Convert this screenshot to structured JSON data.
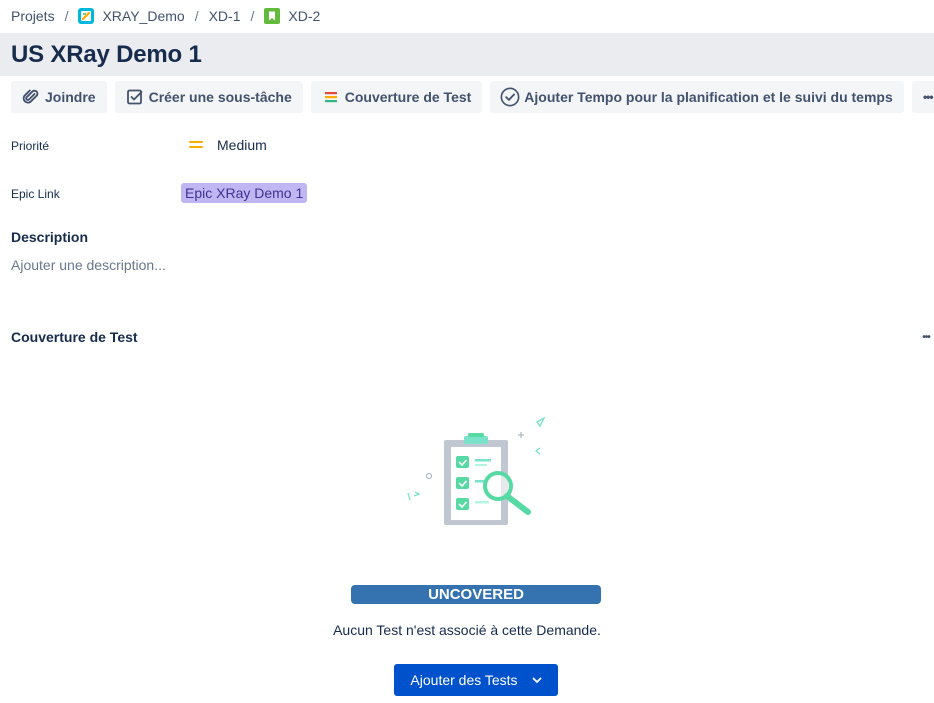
{
  "breadcrumb": {
    "items": [
      "Projets",
      "XRAY_Demo",
      "XD-1",
      "XD-2"
    ],
    "separator": "/"
  },
  "issue": {
    "title": "US XRay Demo 1"
  },
  "toolbar": {
    "attach_label": "Joindre",
    "subtask_label": "Créer une sous-tâche",
    "coverage_label": "Couverture de Test",
    "tempo_label": "Ajouter Tempo pour la planification et le suivi du temps",
    "more_label": "•••"
  },
  "fields": {
    "priority_label": "Priorité",
    "priority_value": "Medium",
    "epic_label": "Epic Link",
    "epic_value": "Epic XRay Demo 1",
    "description_label": "Description",
    "description_placeholder": "Ajouter une description..."
  },
  "coverage": {
    "title": "Couverture de Test",
    "more_label": "•••",
    "status": "UNCOVERED",
    "message": "Aucun Test n'est associé à cette Demande.",
    "add_button": "Ajouter des Tests"
  },
  "colors": {
    "title_bg": "#ebecf0",
    "button_bg": "#f4f5f7",
    "epic_bg": "#c0b6f2",
    "status_bg": "#3572b0",
    "primary": "#0052cc",
    "priority_medium": "#ffab00"
  },
  "icons": {
    "project": "xray-project-icon",
    "epic_story": "story-icon",
    "attach": "paperclip-icon",
    "subtask": "checkbox-icon",
    "coverage": "coverage-bars-icon",
    "tempo": "check-circle-icon",
    "priority": "priority-medium-icon",
    "add_chevron": "chevron-down-icon"
  }
}
